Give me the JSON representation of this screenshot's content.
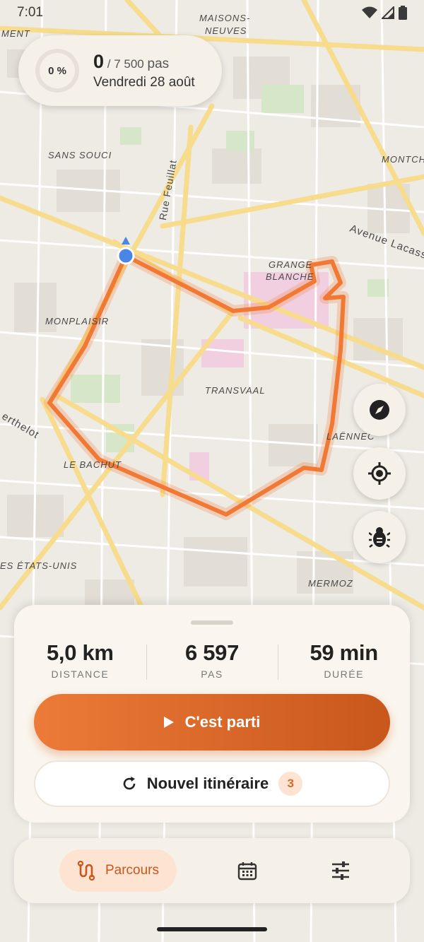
{
  "status": {
    "time": "7:01"
  },
  "progress": {
    "percent": "0 %",
    "steps_done": "0",
    "steps_goal": "/ 7 500",
    "steps_unit": "pas",
    "date": "Vendredi 28 août",
    "fraction": 0
  },
  "map": {
    "labels": {
      "maisons": "MAISONS-",
      "neuves": "NEUVES",
      "ment": "MENT",
      "sans_souci": "SANS SOUCI",
      "montch": "MONTCH",
      "rue_feuillat": "Rue Feuillat",
      "avenue_lacass": "Avenue Lacass",
      "grange": "GRANGE",
      "blanche": "BLANCHE",
      "monplaisir": "MONPLAISIR",
      "transvaal": "TRANSVAAL",
      "erthelot": "erthelot",
      "laennec": "LAËNNEC",
      "le_bachut": "LE BACHUT",
      "etats_unis": "ES ÉTATS-UNIS",
      "mermoz": "MERMOZ"
    },
    "route_color": "#f07a35"
  },
  "fab": {
    "compass_icon": "compass-icon",
    "locate_icon": "crosshair-icon",
    "debug_icon": "bug-icon"
  },
  "summary": {
    "distance_value": "5,0 km",
    "distance_label": "DISTANCE",
    "steps_value": "6 597",
    "steps_label": "PAS",
    "duration_value": "59 min",
    "duration_label": "DURÉE",
    "start_label": "C'est parti",
    "new_route_label": "Nouvel itinéraire",
    "new_route_count": "3"
  },
  "nav": {
    "route_label": "Parcours"
  },
  "colors": {
    "accent": "#e8722f",
    "accent_dark": "#c8571c",
    "card": "#f6f1e8"
  }
}
